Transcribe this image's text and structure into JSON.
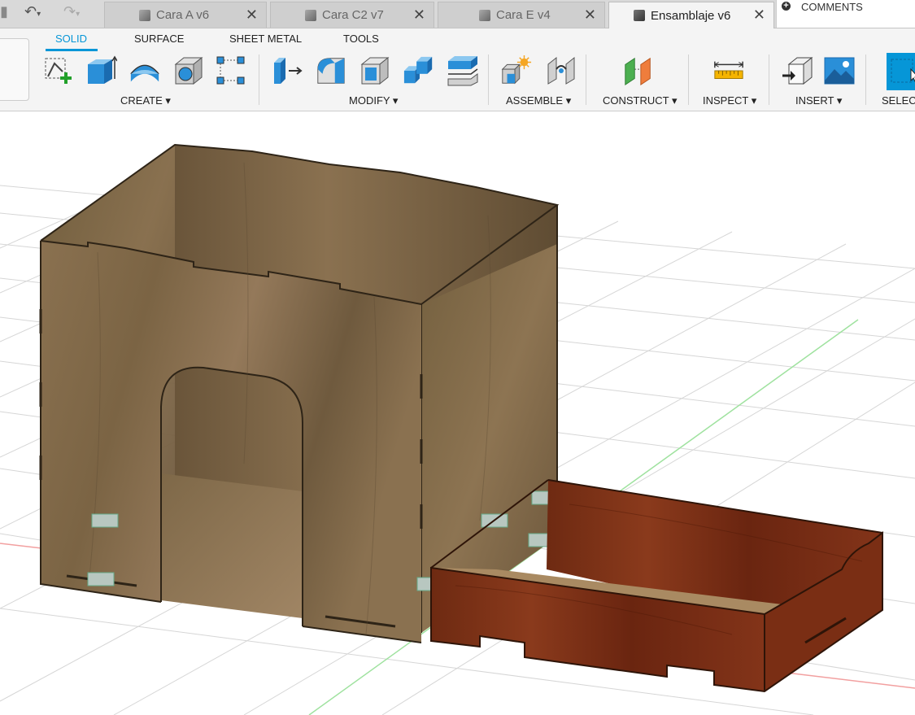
{
  "quick_access": {
    "undo_icon": "undo-icon",
    "redo_icon": "redo-icon"
  },
  "tabs": [
    {
      "label": "Cara A v6",
      "active": false
    },
    {
      "label": "Cara C2 v7",
      "active": false
    },
    {
      "label": "Cara E v4",
      "active": false
    },
    {
      "label": "Ensamblaje v6",
      "active": true
    }
  ],
  "comments": {
    "label": "COMMENTS"
  },
  "workspace_tabs": [
    "SOLID",
    "SURFACE",
    "SHEET METAL",
    "TOOLS"
  ],
  "groups": {
    "create": "CREATE ▾",
    "modify": "MODIFY ▾",
    "assemble": "ASSEMBLE ▾",
    "construct": "CONSTRUCT ▾",
    "inspect": "INSPECT ▾",
    "insert": "INSERT ▾",
    "select": "SELECT"
  },
  "colors": {
    "accent": "#0696d7",
    "wood_light": "#8a7150",
    "wood_dark": "#7a2e14"
  }
}
